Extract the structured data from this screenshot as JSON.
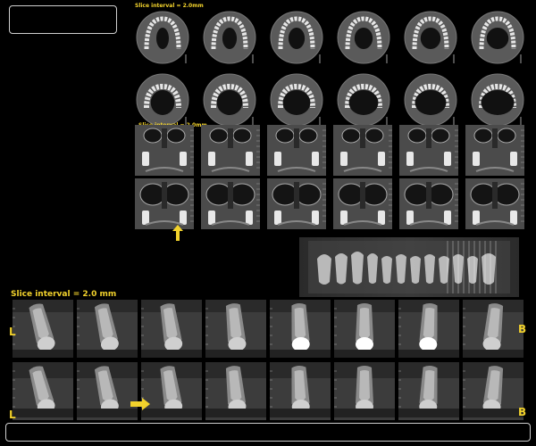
{
  "axial": {
    "slice_label": "Slice interval = 2.0mm",
    "rows": 2,
    "cols": 6
  },
  "coronal": {
    "slice_label": "Slice interval = 2.0mm",
    "rows": 2,
    "cols": 6
  },
  "sagittal": {
    "slice_label": "Slice interval = 2.0 mm",
    "rows": 2,
    "cols": 8,
    "left_marker": "L",
    "right_marker": "B"
  },
  "colors": {
    "arrow": "#f2d22c",
    "label": "#f2d22c",
    "outline": "#cfcfcf"
  }
}
